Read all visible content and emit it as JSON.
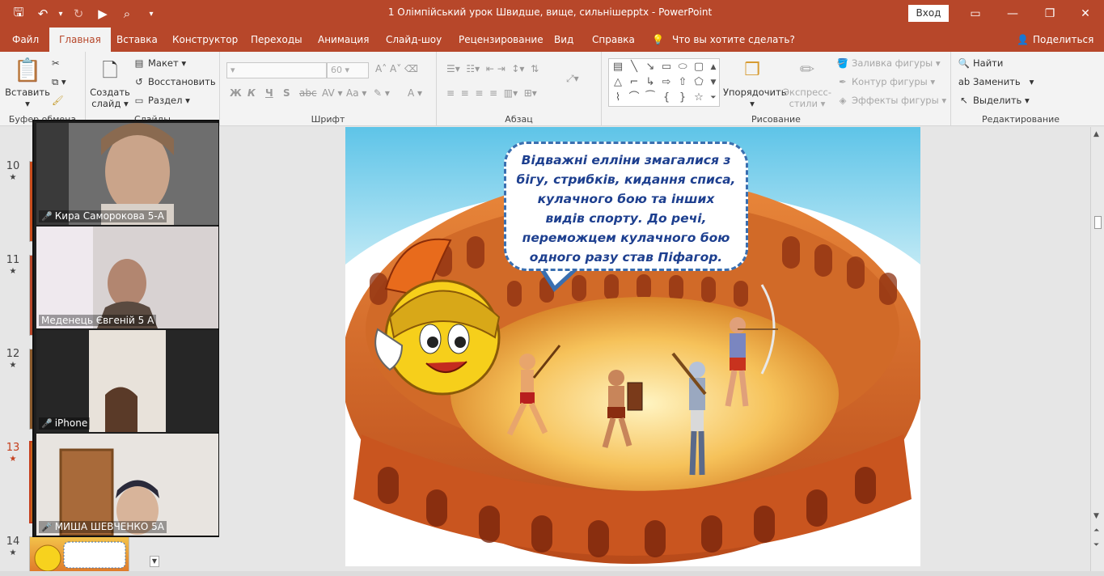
{
  "window": {
    "title": "1 Олімпійський урок Швидше, вище, сильнішерptx  -  PowerPoint",
    "login_label": "Вход",
    "controls": {
      "ribbon": "▭",
      "minimize": "—",
      "maximize": "❐",
      "close": "✕"
    }
  },
  "qat": {
    "save": "🖫",
    "undo": "↶",
    "undo_more": "▾",
    "redo": "↻",
    "present": "▶",
    "preview": "⌕",
    "customize": "▾"
  },
  "menu": {
    "tabs": [
      "Файл",
      "Главная",
      "Вставка",
      "Конструктор",
      "Переходы",
      "Анимация",
      "Слайд-шоу",
      "Рецензирование",
      "Вид",
      "Справка"
    ],
    "active": "Главная",
    "tell_me": "Что вы хотите сделать?",
    "share": "Поделиться"
  },
  "ribbon": {
    "clipboard": {
      "label": "Буфер обмена",
      "paste": "Вставить",
      "paste_arrow": "▾"
    },
    "slides": {
      "label": "Слайды",
      "new_slide": "Создать",
      "new_slide_2": "слайд",
      "layout": "Макет",
      "reset": "Восстановить",
      "section": "Раздел"
    },
    "font": {
      "label": "Шрифт",
      "font_size": "60",
      "bold": "Ж",
      "italic": "К",
      "underline": "Ч",
      "strike": "S",
      "shadow": "abc",
      "spacing": "AV",
      "case": "Aa",
      "color": "A"
    },
    "paragraph": {
      "label": "Абзац"
    },
    "drawing": {
      "label": "Рисование",
      "arrange": "Упорядочить",
      "quick_styles": "Экспресс-",
      "quick_styles_2": "стили",
      "fill": "Заливка фигуры",
      "outline": "Контур фигуры",
      "effects": "Эффекты фигуры"
    },
    "editing": {
      "label": "Редактирование",
      "find": "Найти",
      "replace": "Заменить",
      "select": "Выделить"
    }
  },
  "slides_panel": {
    "numbers": [
      "10",
      "11",
      "12",
      "13",
      "14"
    ],
    "star": "★",
    "current": "13"
  },
  "video": {
    "participants": [
      {
        "name": "Кира Саморокова 5-А",
        "muted": true
      },
      {
        "name": "Меденець Євгеній 5 А",
        "muted": false
      },
      {
        "name": "iPhone",
        "muted": true
      },
      {
        "name": "МИША ШЕВЧЕНКО 5А",
        "muted": true
      }
    ],
    "mic_icon": "🎤"
  },
  "slide": {
    "bubble_text": "Відважні елліни змагалися з бігу, стрибків, кидання списа, кулачного бою та інших видів спорту. До речі, переможцем кулачного бою одного разу став Піфагор."
  },
  "colors": {
    "accent": "#b7472a",
    "bubble_text": "#1d3f8f",
    "bubble_border": "#3a6fb0",
    "current_slide": "#c43e1c"
  }
}
